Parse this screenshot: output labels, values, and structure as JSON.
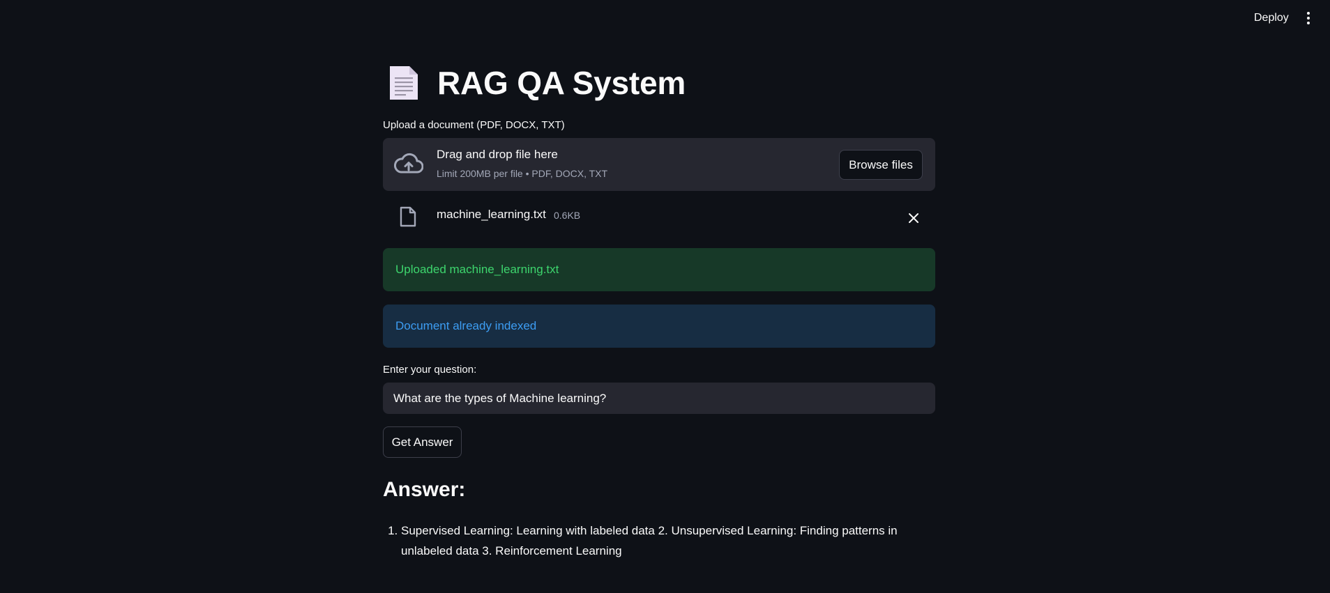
{
  "header": {
    "deploy_label": "Deploy",
    "menu_icon": "vertical-dots-icon"
  },
  "page": {
    "title_icon": "document-icon",
    "title": "RAG QA System"
  },
  "uploader": {
    "label": "Upload a document (PDF, DOCX, TXT)",
    "drop_title": "Drag and drop file here",
    "drop_subtitle": "Limit 200MB per file • PDF, DOCX, TXT",
    "browse_label": "Browse files",
    "icon": "cloud-upload-icon"
  },
  "uploaded_file": {
    "name": "machine_learning.txt",
    "size": "0.6KB",
    "icon": "file-icon",
    "remove_icon": "close-icon"
  },
  "alerts": {
    "success": "Uploaded machine_learning.txt",
    "info": "Document already indexed"
  },
  "question": {
    "label": "Enter your question:",
    "value": "What are the types of Machine learning?"
  },
  "actions": {
    "get_answer_label": "Get Answer"
  },
  "answer": {
    "heading": "Answer:",
    "items": [
      "Supervised Learning: Learning with labeled data 2. Unsupervised Learning: Finding patterns in unlabeled data 3. Reinforcement Learning"
    ]
  },
  "colors": {
    "background": "#0e1117",
    "surface": "#262730",
    "success_bg": "#173928",
    "success_text": "#3dd56d",
    "info_bg": "#172d43",
    "info_text": "#3d9df3"
  }
}
